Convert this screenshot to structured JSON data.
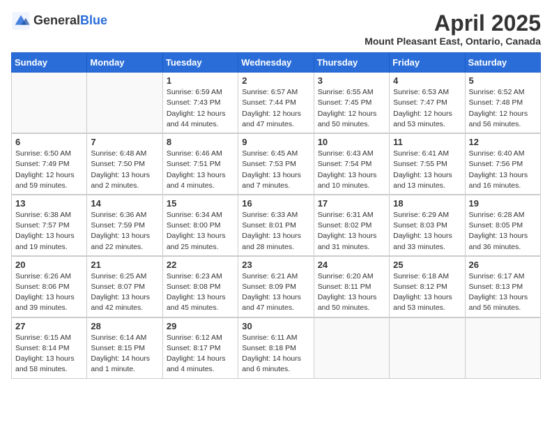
{
  "logo": {
    "text_general": "General",
    "text_blue": "Blue"
  },
  "title": "April 2025",
  "subtitle": "Mount Pleasant East, Ontario, Canada",
  "days_of_week": [
    "Sunday",
    "Monday",
    "Tuesday",
    "Wednesday",
    "Thursday",
    "Friday",
    "Saturday"
  ],
  "weeks": [
    [
      {
        "day": "",
        "info": ""
      },
      {
        "day": "",
        "info": ""
      },
      {
        "day": "1",
        "info": "Sunrise: 6:59 AM\nSunset: 7:43 PM\nDaylight: 12 hours and 44 minutes."
      },
      {
        "day": "2",
        "info": "Sunrise: 6:57 AM\nSunset: 7:44 PM\nDaylight: 12 hours and 47 minutes."
      },
      {
        "day": "3",
        "info": "Sunrise: 6:55 AM\nSunset: 7:45 PM\nDaylight: 12 hours and 50 minutes."
      },
      {
        "day": "4",
        "info": "Sunrise: 6:53 AM\nSunset: 7:47 PM\nDaylight: 12 hours and 53 minutes."
      },
      {
        "day": "5",
        "info": "Sunrise: 6:52 AM\nSunset: 7:48 PM\nDaylight: 12 hours and 56 minutes."
      }
    ],
    [
      {
        "day": "6",
        "info": "Sunrise: 6:50 AM\nSunset: 7:49 PM\nDaylight: 12 hours and 59 minutes."
      },
      {
        "day": "7",
        "info": "Sunrise: 6:48 AM\nSunset: 7:50 PM\nDaylight: 13 hours and 2 minutes."
      },
      {
        "day": "8",
        "info": "Sunrise: 6:46 AM\nSunset: 7:51 PM\nDaylight: 13 hours and 4 minutes."
      },
      {
        "day": "9",
        "info": "Sunrise: 6:45 AM\nSunset: 7:53 PM\nDaylight: 13 hours and 7 minutes."
      },
      {
        "day": "10",
        "info": "Sunrise: 6:43 AM\nSunset: 7:54 PM\nDaylight: 13 hours and 10 minutes."
      },
      {
        "day": "11",
        "info": "Sunrise: 6:41 AM\nSunset: 7:55 PM\nDaylight: 13 hours and 13 minutes."
      },
      {
        "day": "12",
        "info": "Sunrise: 6:40 AM\nSunset: 7:56 PM\nDaylight: 13 hours and 16 minutes."
      }
    ],
    [
      {
        "day": "13",
        "info": "Sunrise: 6:38 AM\nSunset: 7:57 PM\nDaylight: 13 hours and 19 minutes."
      },
      {
        "day": "14",
        "info": "Sunrise: 6:36 AM\nSunset: 7:59 PM\nDaylight: 13 hours and 22 minutes."
      },
      {
        "day": "15",
        "info": "Sunrise: 6:34 AM\nSunset: 8:00 PM\nDaylight: 13 hours and 25 minutes."
      },
      {
        "day": "16",
        "info": "Sunrise: 6:33 AM\nSunset: 8:01 PM\nDaylight: 13 hours and 28 minutes."
      },
      {
        "day": "17",
        "info": "Sunrise: 6:31 AM\nSunset: 8:02 PM\nDaylight: 13 hours and 31 minutes."
      },
      {
        "day": "18",
        "info": "Sunrise: 6:29 AM\nSunset: 8:03 PM\nDaylight: 13 hours and 33 minutes."
      },
      {
        "day": "19",
        "info": "Sunrise: 6:28 AM\nSunset: 8:05 PM\nDaylight: 13 hours and 36 minutes."
      }
    ],
    [
      {
        "day": "20",
        "info": "Sunrise: 6:26 AM\nSunset: 8:06 PM\nDaylight: 13 hours and 39 minutes."
      },
      {
        "day": "21",
        "info": "Sunrise: 6:25 AM\nSunset: 8:07 PM\nDaylight: 13 hours and 42 minutes."
      },
      {
        "day": "22",
        "info": "Sunrise: 6:23 AM\nSunset: 8:08 PM\nDaylight: 13 hours and 45 minutes."
      },
      {
        "day": "23",
        "info": "Sunrise: 6:21 AM\nSunset: 8:09 PM\nDaylight: 13 hours and 47 minutes."
      },
      {
        "day": "24",
        "info": "Sunrise: 6:20 AM\nSunset: 8:11 PM\nDaylight: 13 hours and 50 minutes."
      },
      {
        "day": "25",
        "info": "Sunrise: 6:18 AM\nSunset: 8:12 PM\nDaylight: 13 hours and 53 minutes."
      },
      {
        "day": "26",
        "info": "Sunrise: 6:17 AM\nSunset: 8:13 PM\nDaylight: 13 hours and 56 minutes."
      }
    ],
    [
      {
        "day": "27",
        "info": "Sunrise: 6:15 AM\nSunset: 8:14 PM\nDaylight: 13 hours and 58 minutes."
      },
      {
        "day": "28",
        "info": "Sunrise: 6:14 AM\nSunset: 8:15 PM\nDaylight: 14 hours and 1 minute."
      },
      {
        "day": "29",
        "info": "Sunrise: 6:12 AM\nSunset: 8:17 PM\nDaylight: 14 hours and 4 minutes."
      },
      {
        "day": "30",
        "info": "Sunrise: 6:11 AM\nSunset: 8:18 PM\nDaylight: 14 hours and 6 minutes."
      },
      {
        "day": "",
        "info": ""
      },
      {
        "day": "",
        "info": ""
      },
      {
        "day": "",
        "info": ""
      }
    ]
  ]
}
